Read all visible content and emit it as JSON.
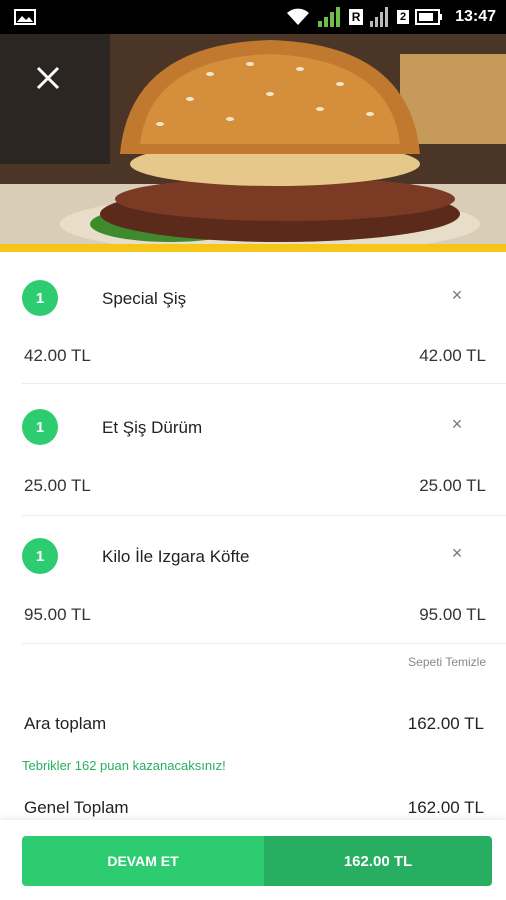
{
  "status_bar": {
    "time": "13:47",
    "sim1_badge": "R",
    "sim2_badge": "2"
  },
  "hero": {
    "close_icon": "close-icon",
    "accent_color": "#f5c518"
  },
  "cart": {
    "items": [
      {
        "qty": "1",
        "name": "Special Şiş",
        "unit_price": "42.00 TL",
        "total_price": "42.00 TL",
        "remove": "×"
      },
      {
        "qty": "1",
        "name": "Et Şiş Dürüm",
        "unit_price": "25.00 TL",
        "total_price": "25.00 TL",
        "remove": "×"
      },
      {
        "qty": "1",
        "name": "Kilo İle Izgara Köfte",
        "unit_price": "95.00 TL",
        "total_price": "95.00 TL",
        "remove": "×"
      }
    ],
    "clear_label": "Sepeti Temizle"
  },
  "summary": {
    "subtotal_label": "Ara toplam",
    "subtotal_value": "162.00 TL",
    "promo_text": "Tebrikler 162 puan kazanacaksınız!",
    "total_label": "Genel Toplam",
    "total_value": "162.00 TL"
  },
  "footer": {
    "continue_label": "DEVAM ET",
    "amount": "162.00 TL"
  },
  "colors": {
    "green": "#2ecc71",
    "dark_green": "#27ae60",
    "yellow": "#f5c518"
  }
}
